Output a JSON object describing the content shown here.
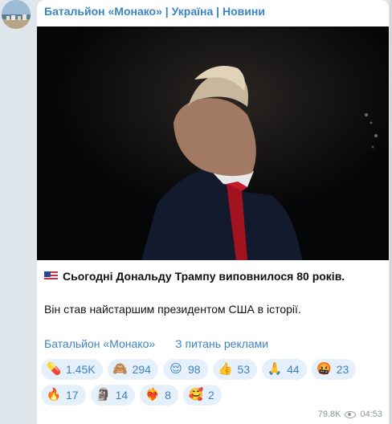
{
  "channel": {
    "name": "Батальйон «Монако» | Україна | Новини"
  },
  "post": {
    "line1": "Сьогодні Дональду Трампу виповнилося 80 років.",
    "line2": "Він став найстаршим президентом США в історії.",
    "links": [
      "Батальйон «Монако»",
      "З питань реклами"
    ],
    "reactions_row1": [
      {
        "icon": "pill-icon",
        "glyph": "💊",
        "count": "1.45K"
      },
      {
        "icon": "monkey-icon",
        "glyph": "🙈",
        "count": "294"
      },
      {
        "icon": "relieved-face-icon",
        "glyph": "😌",
        "count": "98"
      },
      {
        "icon": "thumbs-up-icon",
        "glyph": "👍",
        "count": "53"
      },
      {
        "icon": "praying-hands-icon",
        "glyph": "🙏",
        "count": "44"
      },
      {
        "icon": "angry-face-icon",
        "glyph": "🤬",
        "count": "23"
      }
    ],
    "reactions_row2": [
      {
        "icon": "fire-icon",
        "glyph": "🔥",
        "count": "17"
      },
      {
        "icon": "moai-icon",
        "glyph": "🗿",
        "count": "14"
      },
      {
        "icon": "heart-on-fire-icon",
        "glyph": "❤️‍🔥",
        "count": "8"
      },
      {
        "icon": "smiling-hearts-icon",
        "glyph": "🥰",
        "count": "2"
      }
    ],
    "views": "79.8K",
    "time": "04:53"
  },
  "colors": {
    "accent": "#3b84c4",
    "reaction_bg": "#e6f0fa",
    "chat_bg": "#dfe6ec"
  }
}
